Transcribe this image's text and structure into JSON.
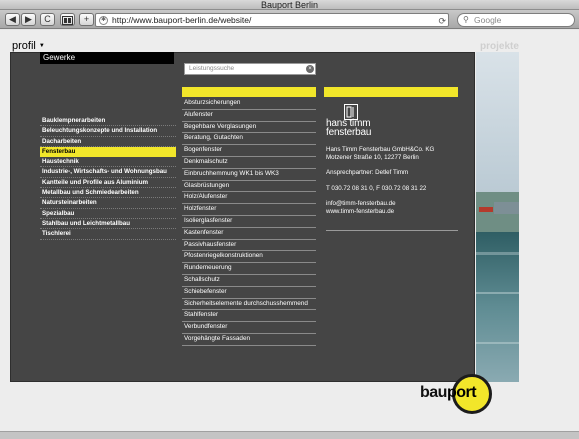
{
  "window": {
    "title": "Bauport Berlin"
  },
  "toolbar": {
    "back_glyph": "◀",
    "forward_glyph": "▶",
    "reload_glyph": "C",
    "url": "http://www.bauport-berlin.de/website/",
    "search_placeholder": "Google"
  },
  "page": {
    "tab_profil": "profil",
    "tab_projekte": "projekte",
    "gewerke_title": "Gewerke",
    "search_placeholder": "Leistungssuche",
    "categories": [
      {
        "label": "Bauklempnerarbeiten",
        "active": false
      },
      {
        "label": "Beleuchtungskonzepte und Installation",
        "active": false
      },
      {
        "label": "Dacharbeiten",
        "active": false
      },
      {
        "label": "Fensterbau",
        "active": true
      },
      {
        "label": "Haustechnik",
        "active": false
      },
      {
        "label": "Industrie-, Wirtschafts- und Wohnungsbau",
        "active": false
      },
      {
        "label": "Kantteile und Profile aus Aluminium",
        "active": false
      },
      {
        "label": "Metallbau und Schmiedearbeiten",
        "active": false
      },
      {
        "label": "Natursteinarbeiten",
        "active": false
      },
      {
        "label": "Spezialbau",
        "active": false
      },
      {
        "label": "Stahlbau und Leichtmetallbau",
        "active": false
      },
      {
        "label": "Tischlerei",
        "active": false
      }
    ],
    "services": [
      "Absturzsicherungen",
      "Alufenster",
      "Begehbare Verglasungen",
      "Beratung, Gutachten",
      "Bogenfenster",
      "Denkmalschutz",
      "Einbruchhemmung WK1 bis WK3",
      "Glasbrüstungen",
      "Holz/Alufenster",
      "Holzfenster",
      "Isolierglasfenster",
      "Kastenfenster",
      "Passivhausfenster",
      "Pfostenriegelkonstruktionen",
      "Rundemeuerung",
      "Schallschutz",
      "Schiebefenster",
      "Sicherheitselemente durchschusshemmend",
      "Stahlfenster",
      "Verbundfenster",
      "Vorgehängte Fassaden"
    ],
    "company": {
      "logo_line1": "hans timm",
      "logo_line2": "fensterbau",
      "name": "Hans Timm Fensterbau GmbH&Co. KG",
      "address": "Motzener Straße 10, 12277 Berlin",
      "contact": "Ansprechpartner: Detlef Timm",
      "phone": "T  030.72 08 31 0, F  030.72 08 31 22",
      "email": "info@timm-fensterbau.de",
      "web": "www.timm-fensterbau.de"
    },
    "brand": {
      "part1": "bau",
      "part2": "port"
    },
    "accent_color": "#f2e62a"
  }
}
